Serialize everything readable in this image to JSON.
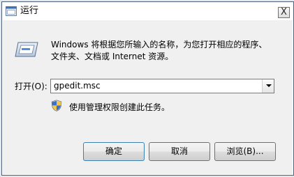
{
  "window": {
    "title": "运行",
    "close_label": "X"
  },
  "main": {
    "description": "Windows 将根据您所输入的名称，为您打开相应的程序、文件夹、文档或 Internet 资源。",
    "open_label": "打开(O):",
    "command_value": "gpedit.msc",
    "admin_note": "使用管理权限创建此任务。"
  },
  "buttons": {
    "ok": "确定",
    "cancel": "取消",
    "browse": "浏览(B)..."
  },
  "icons": {
    "title": "run-app-icon",
    "main": "run-dialog-icon",
    "shield": "uac-shield-icon",
    "dropdown": "chevron-down-icon"
  },
  "colors": {
    "window_bg": "#f0f0f0",
    "titlebar_bg": "#ffffff",
    "ok_border": "#3c7fb1"
  }
}
